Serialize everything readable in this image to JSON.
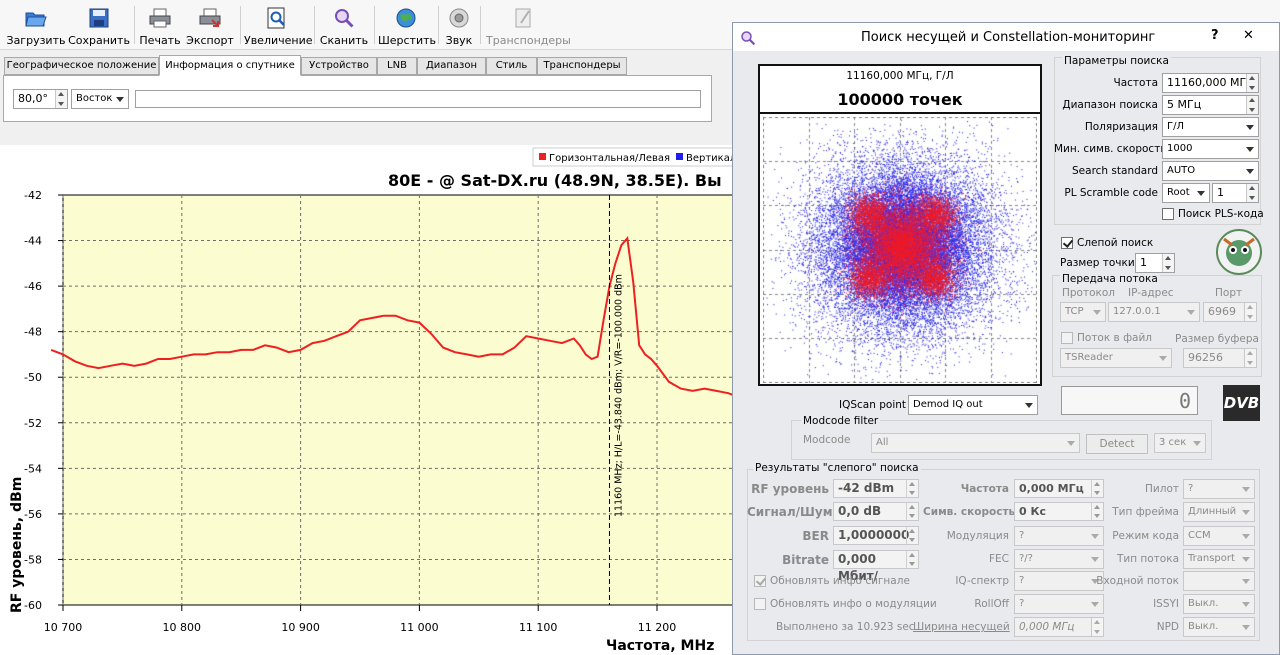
{
  "toolbar": {
    "items": [
      {
        "label": "Загрузить",
        "icon": "folder-open-icon"
      },
      {
        "label": "Сохранить",
        "icon": "floppy-disk-icon"
      },
      {
        "label": "Печать",
        "icon": "printer-icon"
      },
      {
        "label": "Экспорт",
        "icon": "export-printer-icon"
      },
      {
        "label": "Увеличение",
        "icon": "zoom-icon"
      },
      {
        "label": "Сканить",
        "icon": "scan-magnifier-icon"
      },
      {
        "label": "Шерстить",
        "icon": "globe-scan-icon"
      },
      {
        "label": "Звук",
        "icon": "speaker-icon"
      },
      {
        "label": "Транспондеры",
        "icon": "transponders-icon",
        "disabled": true
      }
    ]
  },
  "tabs": [
    "Географическое положение",
    "Информация о спутнике",
    "Устройство",
    "LNB",
    "Диапазон",
    "Стиль",
    "Транспондеры"
  ],
  "active_tab": 1,
  "satellite": {
    "position": "80,0°",
    "direction": "Восток",
    "name": ""
  },
  "chart_data": {
    "type": "line",
    "title": "80E -  @ Sat-DX.ru (48.9N, 38.5E). Вы",
    "xlabel": "Частота, MHz",
    "ylabel": "RF уровень, dBm",
    "xlim": [
      10690,
      11265
    ],
    "ylim": [
      -60,
      -42
    ],
    "xticks": [
      10700,
      10800,
      10900,
      11000,
      11100,
      11200
    ],
    "xtick_labels": [
      "10 700",
      "10 800",
      "10 900",
      "11 000",
      "11 100",
      "11 200"
    ],
    "yticks": [
      -60,
      -58,
      -56,
      -54,
      -52,
      -50,
      -48,
      -46,
      -44,
      -42
    ],
    "legend": [
      {
        "name": "Горизонтальная/Левая",
        "color": "#ee2020"
      },
      {
        "name": "Вертикал",
        "color": "#2020ee"
      }
    ],
    "series": [
      {
        "name": "Горизонтальная/Левая",
        "color": "#ee2020",
        "x": [
          10690,
          10700,
          10710,
          10720,
          10730,
          10740,
          10750,
          10760,
          10770,
          10780,
          10790,
          10800,
          10810,
          10820,
          10830,
          10840,
          10850,
          10860,
          10870,
          10880,
          10890,
          10900,
          10910,
          10920,
          10930,
          10940,
          10950,
          10960,
          10970,
          10980,
          10990,
          11000,
          11010,
          11020,
          11030,
          11040,
          11050,
          11060,
          11070,
          11080,
          11090,
          11100,
          11110,
          11120,
          11130,
          11135,
          11140,
          11145,
          11150,
          11155,
          11160,
          11165,
          11170,
          11175,
          11180,
          11185,
          11190,
          11195,
          11200,
          11210,
          11220,
          11230,
          11240,
          11250,
          11260,
          11265
        ],
        "y": [
          -48.8,
          -49.0,
          -49.3,
          -49.5,
          -49.6,
          -49.5,
          -49.4,
          -49.5,
          -49.4,
          -49.2,
          -49.2,
          -49.1,
          -49.0,
          -49.0,
          -48.9,
          -48.9,
          -48.8,
          -48.8,
          -48.6,
          -48.7,
          -48.9,
          -48.8,
          -48.5,
          -48.4,
          -48.2,
          -48.0,
          -47.5,
          -47.4,
          -47.3,
          -47.3,
          -47.5,
          -47.6,
          -48.1,
          -48.7,
          -48.9,
          -49.0,
          -49.1,
          -49.0,
          -49.0,
          -48.7,
          -48.2,
          -48.3,
          -48.4,
          -48.5,
          -48.3,
          -48.6,
          -49.0,
          -49.2,
          -49.1,
          -47.5,
          -46.0,
          -45.0,
          -44.2,
          -43.9,
          -45.8,
          -48.6,
          -49.0,
          -49.2,
          -49.5,
          -50.2,
          -50.5,
          -50.6,
          -50.5,
          -50.6,
          -50.7,
          -50.8
        ]
      }
    ],
    "annotation": {
      "x": 11160,
      "text": "11160 MHz; H/L=-43.840 dBm; V/R=-100.000 dBm"
    }
  },
  "dialog": {
    "title": "Поиск несущей и Constellation-мониторинг",
    "help": "?",
    "close": "✕",
    "constellation": {
      "caption": "11160,000 МГц, Г/Л",
      "points_label": "100000 точек"
    },
    "params": {
      "group_title": "Параметры поиска",
      "freq_label": "Частота",
      "freq_value": "11160,000 МГц",
      "range_label": "Диапазон поиска",
      "range_value": "5 МГц",
      "pol_label": "Поляризация",
      "pol_value": "Г/Л",
      "sr_label": "Мин. симв. скорость",
      "sr_value": "1000",
      "std_label": "Search standard",
      "std_value": "AUTO",
      "pls_label": "PL Scramble code",
      "pls_mode": "Root",
      "pls_value": "1",
      "pls_search": "Поиск PLS-кода"
    },
    "blind_search": "Слепой поиск",
    "point_size_label": "Размер точки",
    "point_size": "1",
    "stream": {
      "title": "Передача потока",
      "protocol_label": "Протокол",
      "ip_label": "IP-адрес",
      "port_label": "Порт",
      "protocol": "TCP",
      "ip": "127.0.0.1",
      "port": "6969",
      "file_label": "Поток в файл",
      "buffer_label": "Размер буфера",
      "reader": "TSReader",
      "buffer": "96256"
    },
    "counter": "0",
    "dvb_logo": "DVB",
    "iqscan_label": "IQScan point",
    "iqscan_value": "Demod IQ out",
    "modcode": {
      "group_title": "Modcode filter",
      "label": "Modcode",
      "value": "All",
      "detect": "Detect",
      "time": "3 сек"
    },
    "results": {
      "title": "Результаты \"слепого\" поиска",
      "rf_label": "RF уровень",
      "rf_value": "-42 dBm",
      "snr_label": "Сигнал/Шум",
      "snr_value": "0,0 dB",
      "ber_label": "BER",
      "ber_value": "1,0000000",
      "bitrate_label": "Bitrate",
      "bitrate_value": "0,000 Мбит/",
      "freq_label": "Частота",
      "freq_value": "0,000 МГц",
      "sr_label": "Симв. скорость",
      "sr_value": "0 Кс",
      "mod_label": "Модуляция",
      "mod_value": "?",
      "fec_label": "FEC",
      "fec_value": "?/?",
      "iq_label": "IQ-спектр",
      "iq_value": "?",
      "rolloff_label": "RollOff",
      "rolloff_value": "?",
      "bw_label": "Ширина несущей",
      "bw_value": "0,000 МГц",
      "pilot_label": "Пилот",
      "pilot_value": "?",
      "frame_label": "Тип фрейма",
      "frame_value": "Длинный",
      "coding_label": "Режим кода",
      "coding_value": "CCM",
      "stream_label": "Тип потока",
      "stream_value": "Transport",
      "input_label": "Входной поток",
      "input_value": "",
      "issyi_label": "ISSYI",
      "issyi_value": "Выкл.",
      "npd_label": "NPD",
      "npd_value": "Выкл.",
      "upd_signal": "Обновлять инфо сигнале",
      "upd_mod": "Обновлять инфо о модуляции",
      "done": "Выполнено за 10.923 sec"
    }
  }
}
